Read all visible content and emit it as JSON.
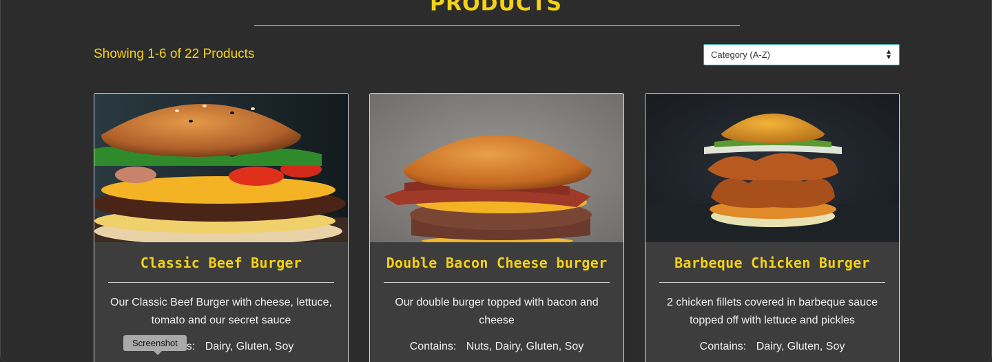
{
  "page": {
    "title": "PRODUCTS",
    "results_text": "Showing 1-6 of 22 Products",
    "sort": {
      "selected": "Category (A-Z)"
    }
  },
  "products": [
    {
      "name": "Classic Beef Burger",
      "description": "Our Classic Beef Burger with cheese, lettuce, tomato and our secret sauce",
      "contains_label": "Contains:",
      "allergens": "Dairy, Gluten, Soy"
    },
    {
      "name": "Double Bacon Cheese burger",
      "description": "Our double burger topped with bacon and cheese",
      "contains_label": "Contains:",
      "allergens": "Nuts, Dairy, Gluten, Soy"
    },
    {
      "name": "Barbeque Chicken Burger",
      "description": "2 chicken fillets covered in barbeque sauce topped off with lettuce and pickles",
      "contains_label": "Contains:",
      "allergens": "Dairy, Gluten, Soy"
    }
  ],
  "tooltip": {
    "text": "Screenshot"
  },
  "colors": {
    "accent": "#f5d216",
    "background": "#2c2c2c",
    "card": "#3d3d3d"
  }
}
